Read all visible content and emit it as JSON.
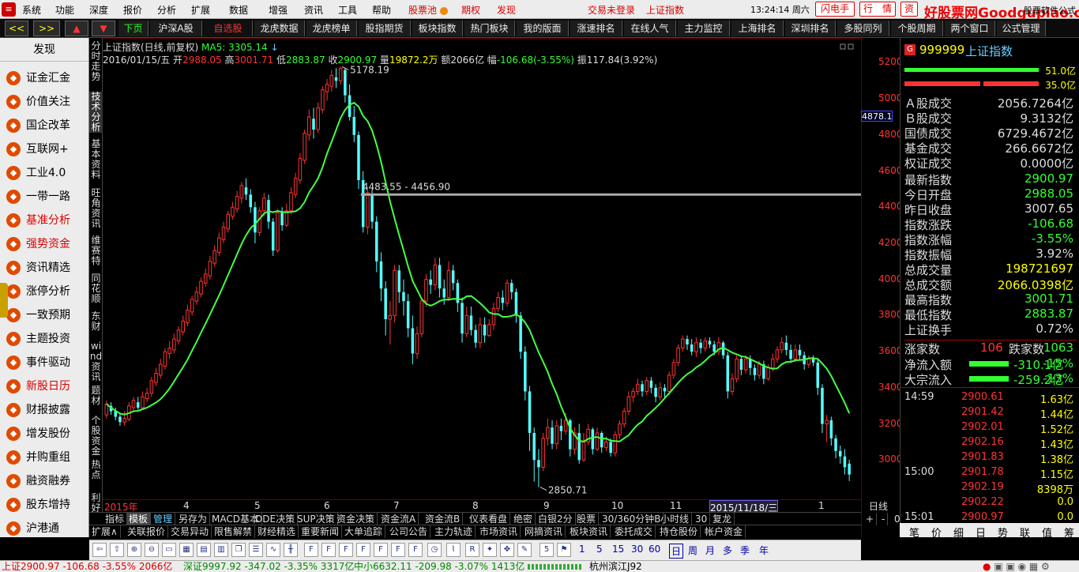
{
  "menubar": {
    "items": [
      "系统",
      "功能",
      "深度",
      "报价",
      "分析",
      "扩展",
      "数据",
      "增强",
      "资讯",
      "工具",
      "帮助"
    ],
    "pool_label": "股票池",
    "options_label": "期权",
    "discover_label": "发现",
    "login_status": "交易未登录",
    "index_name": "上证指数",
    "time": "13:24:14 周六",
    "flash_label": "闪电手",
    "quote_label": "行　情",
    "asset_label": "资",
    "brand": "好股票网Goodgupiao.com",
    "brand2": "股票软件公式"
  },
  "toolbar": {
    "nav": [
      "<<",
      ">>",
      "▲",
      "▼"
    ],
    "items": [
      "下页",
      "沪深A股",
      "自选股",
      "龙虎数据",
      "龙虎榜单",
      "股指期货",
      "板块指数",
      "热门板块",
      "我的版面",
      "涨速排名",
      "在线人气",
      "主力监控",
      "上海排名",
      "深圳排名",
      "多股同列",
      "个股周期",
      "两个窗口",
      "公式管理"
    ]
  },
  "sidebar": {
    "title": "发现",
    "items": [
      "证金汇金",
      "价值关注",
      "国企改革",
      "互联网+",
      "工业4.0",
      "一带一路",
      "基准分析",
      "强势资金",
      "资讯精选",
      "涨停分析",
      "一致预期",
      "主题投资",
      "事件驱动",
      "新股日历",
      "财报披露",
      "增发股份",
      "并购重组",
      "融资融券",
      "股东增持",
      "沪港通"
    ],
    "icons": [
      "chart-icon",
      "coin-icon",
      "globe-icon",
      "line-chart-icon",
      "gear-icon",
      "umbrella-icon",
      "scale-icon",
      "wallet-icon",
      "news-icon",
      "bars-icon",
      "target-icon",
      "bars-icon",
      "user-icon",
      "calendar-icon",
      "doc-icon",
      "people-icon",
      "link-icon",
      "money-icon",
      "user-icon",
      "bridge-icon"
    ]
  },
  "vtabs": [
    "分时走势",
    "技术分析",
    "基本资料",
    "旺角资讯",
    "维赛特",
    "同花顺",
    "东财",
    "wind资讯",
    "题材",
    "个股资金",
    "热点",
    "利好"
  ],
  "chart": {
    "title_line": "上证指数(日线,前复权)",
    "ma_label": "MA5: 3305.14",
    "info": {
      "date": "2016/01/15/五",
      "open_label": "开",
      "open": "2988.05",
      "high_label": "高",
      "high": "3001.71",
      "low_label": "低",
      "low": "2883.87",
      "close_label": "收",
      "close": "2900.97",
      "vol_label": "量",
      "vol": "19872.2万",
      "amt_label": "额",
      "amt": "2066亿",
      "chg_label": "幅",
      "chg": "-106.68(-3.55%)",
      "amp_label": "振",
      "amp": "117.84(3.92%)"
    },
    "annotations": {
      "high": "5178.19",
      "low": "2850.71",
      "range": "4483.55 - 4456.90"
    },
    "current_price_tag": "4878.1",
    "x_labels": [
      "2015年",
      "4",
      "5",
      "6",
      "7",
      "8",
      "9",
      "10",
      "11",
      "2015/11/18/三",
      "1"
    ],
    "period": "日线"
  },
  "chart_data": {
    "type": "candlestick",
    "title": "上证指数(日线,前复权)",
    "ylim": [
      2800,
      5250
    ],
    "yticks": [
      3000,
      3200,
      3400,
      3600,
      3800,
      4000,
      4200,
      4400,
      4600,
      4800,
      5000,
      5200
    ],
    "colors": {
      "up": "#ff3333",
      "down": "#55ffff",
      "ma": "#44ff44"
    },
    "ma5_last": 3305.14,
    "candles": [
      [
        3250,
        3310,
        3230,
        3330
      ],
      [
        3300,
        3270,
        3250,
        3320
      ],
      [
        3270,
        3240,
        3220,
        3290
      ],
      [
        3240,
        3210,
        3190,
        3260
      ],
      [
        3210,
        3230,
        3190,
        3270
      ],
      [
        3225,
        3300,
        3215,
        3320
      ],
      [
        3290,
        3330,
        3270,
        3350
      ],
      [
        3320,
        3290,
        3280,
        3350
      ],
      [
        3290,
        3350,
        3280,
        3380
      ],
      [
        3340,
        3370,
        3320,
        3400
      ],
      [
        3370,
        3440,
        3350,
        3460
      ],
      [
        3430,
        3480,
        3410,
        3510
      ],
      [
        3470,
        3530,
        3450,
        3560
      ],
      [
        3520,
        3600,
        3500,
        3620
      ],
      [
        3590,
        3620,
        3560,
        3660
      ],
      [
        3610,
        3670,
        3590,
        3700
      ],
      [
        3660,
        3720,
        3640,
        3740
      ],
      [
        3710,
        3770,
        3690,
        3800
      ],
      [
        3760,
        3830,
        3740,
        3860
      ],
      [
        3820,
        3890,
        3800,
        3910
      ],
      [
        3880,
        3930,
        3860,
        3960
      ],
      [
        3920,
        3990,
        3900,
        4010
      ],
      [
        3980,
        4030,
        3960,
        4060
      ],
      [
        4020,
        4100,
        4000,
        4130
      ],
      [
        4090,
        4160,
        4070,
        4190
      ],
      [
        4150,
        4230,
        4130,
        4260
      ],
      [
        4220,
        4290,
        4200,
        4320
      ],
      [
        4280,
        4360,
        4260,
        4380
      ],
      [
        4350,
        4400,
        4330,
        4430
      ],
      [
        4390,
        4460,
        4370,
        4490
      ],
      [
        4450,
        4520,
        4420,
        4540
      ],
      [
        4510,
        4470,
        4440,
        4560
      ],
      [
        4470,
        4400,
        4370,
        4500
      ],
      [
        4400,
        4260,
        4200,
        4430
      ],
      [
        4260,
        4380,
        4240,
        4400
      ],
      [
        4380,
        4450,
        4350,
        4480
      ],
      [
        4440,
        4320,
        4280,
        4470
      ],
      [
        4320,
        4160,
        4130,
        4340
      ],
      [
        4160,
        4370,
        4150,
        4390
      ],
      [
        4370,
        4300,
        4270,
        4400
      ],
      [
        4300,
        4380,
        4290,
        4420
      ],
      [
        4380,
        4480,
        4360,
        4510
      ],
      [
        4470,
        4560,
        4450,
        4590
      ],
      [
        4550,
        4670,
        4530,
        4700
      ],
      [
        4660,
        4810,
        4640,
        4830
      ],
      [
        4800,
        4900,
        4770,
        4940
      ],
      [
        4890,
        4830,
        4780,
        4950
      ],
      [
        4830,
        4950,
        4810,
        4980
      ],
      [
        4940,
        5050,
        4920,
        5070
      ],
      [
        5040,
        5080,
        4990,
        5110
      ],
      [
        5070,
        5130,
        5040,
        5160
      ],
      [
        5120,
        5100,
        5060,
        5170
      ],
      [
        5100,
        5170,
        5080,
        5178
      ],
      [
        5160,
        5020,
        4980,
        5170
      ],
      [
        5020,
        4900,
        4880,
        5080
      ],
      [
        4900,
        4800,
        4760,
        4960
      ],
      [
        4800,
        4550,
        4500,
        4820
      ],
      [
        4550,
        4290,
        4260,
        4600
      ],
      [
        4290,
        4480,
        4250,
        4500
      ],
      [
        4470,
        4320,
        4280,
        4500
      ],
      [
        4320,
        4100,
        4040,
        4350
      ],
      [
        4100,
        3950,
        3880,
        4150
      ],
      [
        3950,
        3780,
        3690,
        3990
      ],
      [
        3780,
        3800,
        3640,
        3880
      ],
      [
        3800,
        4050,
        3760,
        4080
      ],
      [
        4050,
        3930,
        3870,
        4080
      ],
      [
        3930,
        3880,
        3800,
        4000
      ],
      [
        3880,
        3730,
        3680,
        3920
      ],
      [
        3730,
        3590,
        3530,
        3800
      ],
      [
        3590,
        3700,
        3560,
        3740
      ],
      [
        3700,
        3880,
        3680,
        3900
      ],
      [
        3880,
        4000,
        3850,
        4030
      ],
      [
        4000,
        3970,
        3920,
        4050
      ],
      [
        3970,
        4080,
        3940,
        4120
      ],
      [
        4080,
        3950,
        3900,
        4120
      ],
      [
        3950,
        3900,
        3860,
        4000
      ],
      [
        3900,
        4050,
        3880,
        4100
      ],
      [
        4050,
        3980,
        3940,
        4080
      ],
      [
        3980,
        3870,
        3820,
        4000
      ],
      [
        3870,
        3700,
        3650,
        3900
      ],
      [
        3700,
        3800,
        3680,
        3850
      ],
      [
        3800,
        3720,
        3690,
        3850
      ],
      [
        3720,
        3650,
        3620,
        3750
      ],
      [
        3650,
        3750,
        3620,
        3790
      ],
      [
        3750,
        3690,
        3650,
        3790
      ],
      [
        3690,
        3750,
        3680,
        3780
      ],
      [
        3750,
        3840,
        3720,
        3870
      ],
      [
        3840,
        3900,
        3820,
        3930
      ],
      [
        3900,
        3870,
        3830,
        3940
      ],
      [
        3870,
        3980,
        3850,
        4000
      ],
      [
        3980,
        3930,
        3890,
        4000
      ],
      [
        3930,
        3800,
        3760,
        3950
      ],
      [
        3800,
        3600,
        3560,
        3820
      ],
      [
        3600,
        3380,
        3330,
        3630
      ],
      [
        3380,
        3150,
        3050,
        3410
      ],
      [
        3150,
        3000,
        2880,
        3180
      ],
      [
        3000,
        2960,
        2850,
        3060
      ],
      [
        2960,
        3120,
        2940,
        3150
      ],
      [
        3120,
        3180,
        3080,
        3230
      ],
      [
        3180,
        3090,
        3060,
        3220
      ],
      [
        3090,
        3190,
        3060,
        3220
      ],
      [
        3190,
        3160,
        3110,
        3230
      ],
      [
        3160,
        3220,
        3140,
        3260
      ],
      [
        3220,
        3060,
        3020,
        3230
      ],
      [
        3060,
        3150,
        3030,
        3180
      ],
      [
        3150,
        3000,
        2980,
        3200
      ],
      [
        3000,
        3100,
        2990,
        3150
      ],
      [
        3100,
        3170,
        3080,
        3200
      ],
      [
        3170,
        3060,
        3030,
        3180
      ],
      [
        3060,
        3150,
        3050,
        3180
      ],
      [
        3150,
        3070,
        3040,
        3160
      ],
      [
        3070,
        3100,
        3050,
        3130
      ],
      [
        3100,
        3040,
        3020,
        3120
      ],
      [
        3040,
        3140,
        3020,
        3160
      ],
      [
        3140,
        3200,
        3120,
        3220
      ],
      [
        3200,
        3270,
        3180,
        3290
      ],
      [
        3270,
        3350,
        3250,
        3380
      ],
      [
        3350,
        3380,
        3320,
        3400
      ],
      [
        3380,
        3420,
        3360,
        3450
      ],
      [
        3420,
        3380,
        3350,
        3440
      ],
      [
        3380,
        3440,
        3360,
        3460
      ],
      [
        3440,
        3400,
        3370,
        3460
      ],
      [
        3400,
        3350,
        3320,
        3420
      ],
      [
        3350,
        3400,
        3330,
        3430
      ],
      [
        3400,
        3380,
        3340,
        3420
      ],
      [
        3380,
        3470,
        3360,
        3490
      ],
      [
        3470,
        3540,
        3450,
        3560
      ],
      [
        3540,
        3620,
        3520,
        3640
      ],
      [
        3620,
        3670,
        3600,
        3690
      ],
      [
        3670,
        3640,
        3610,
        3690
      ],
      [
        3640,
        3600,
        3580,
        3670
      ],
      [
        3600,
        3650,
        3570,
        3680
      ],
      [
        3650,
        3620,
        3590,
        3670
      ],
      [
        3620,
        3660,
        3600,
        3680
      ],
      [
        3660,
        3640,
        3620,
        3680
      ],
      [
        3640,
        3600,
        3580,
        3660
      ],
      [
        3600,
        3650,
        3580,
        3680
      ],
      [
        3650,
        3580,
        3560,
        3660
      ],
      [
        3580,
        3380,
        3340,
        3600
      ],
      [
        3380,
        3450,
        3360,
        3480
      ],
      [
        3450,
        3560,
        3430,
        3580
      ],
      [
        3560,
        3500,
        3470,
        3580
      ],
      [
        3500,
        3560,
        3480,
        3580
      ],
      [
        3560,
        3510,
        3470,
        3580
      ],
      [
        3510,
        3470,
        3440,
        3530
      ],
      [
        3470,
        3530,
        3450,
        3550
      ],
      [
        3530,
        3450,
        3420,
        3550
      ],
      [
        3450,
        3510,
        3440,
        3530
      ],
      [
        3510,
        3560,
        3490,
        3590
      ],
      [
        3560,
        3610,
        3540,
        3630
      ],
      [
        3610,
        3650,
        3590,
        3680
      ],
      [
        3650,
        3610,
        3580,
        3690
      ],
      [
        3610,
        3560,
        3540,
        3640
      ],
      [
        3560,
        3610,
        3540,
        3640
      ],
      [
        3610,
        3580,
        3550,
        3640
      ],
      [
        3580,
        3530,
        3500,
        3600
      ],
      [
        3530,
        3560,
        3510,
        3580
      ],
      [
        3560,
        3540,
        3520,
        3580
      ],
      [
        3540,
        3400,
        3360,
        3560
      ],
      [
        3400,
        3200,
        3150,
        3420
      ],
      [
        3200,
        3220,
        3100,
        3250
      ],
      [
        3220,
        3120,
        3080,
        3240
      ],
      [
        3120,
        3050,
        3010,
        3140
      ],
      [
        3050,
        3020,
        2980,
        3080
      ],
      [
        3020,
        2960,
        2920,
        3060
      ],
      [
        2980,
        2920,
        2884,
        3002
      ]
    ]
  },
  "yaxis": [
    "5200",
    "5000",
    "4800",
    "4600",
    "4400",
    "4200",
    "4000",
    "3800",
    "3600",
    "3400",
    "3200",
    "3000"
  ],
  "tabs_row1": [
    "指标",
    "模板",
    "管理",
    "另存为",
    "MACD基本",
    "DDE决策",
    "SUP决策",
    "资金决策",
    "资金流A",
    "资金流B",
    "仪表看盘",
    "绝密",
    "白银2分",
    "股票",
    "30/360分钟B",
    "小时线",
    "30",
    "复龙"
  ],
  "tabs_row1_extra": [
    "+",
    "-",
    "0"
  ],
  "tabs_row2": [
    "扩展∧",
    "关联报价",
    "交易异动",
    "限售解禁",
    "财经精选",
    "重要新闻",
    "大单追踪",
    "公司公告",
    "主力轨迹",
    "市场资讯",
    "网摘资讯",
    "板块资讯",
    "委托成交",
    "持仓股份",
    "帐户资金"
  ],
  "drawtools": {
    "periods": [
      "1",
      "5",
      "15",
      "30",
      "60",
      "日",
      "周",
      "月",
      "多",
      "季",
      "年"
    ]
  },
  "rightpanel": {
    "code": "999999",
    "name": "上证指数",
    "bar1_pct": "51.0亿",
    "bar2_pct": "35.0亿",
    "rows": [
      {
        "label": "Ａ股成交",
        "value": "2056.7264亿",
        "cls": ""
      },
      {
        "label": "Ｂ股成交",
        "value": "9.3132亿",
        "cls": ""
      },
      {
        "label": "国债成交",
        "value": "6729.4672亿",
        "cls": ""
      },
      {
        "label": "基金成交",
        "value": "266.6672亿",
        "cls": ""
      },
      {
        "label": "权证成交",
        "value": "0.0000亿",
        "cls": ""
      },
      {
        "label": "最新指数",
        "value": "2900.97",
        "cls": "g"
      },
      {
        "label": "今日开盘",
        "value": "2988.05",
        "cls": "g"
      },
      {
        "label": "昨日收盘",
        "value": "3007.65",
        "cls": ""
      },
      {
        "label": "指数涨跌",
        "value": "-106.68",
        "cls": "g"
      },
      {
        "label": "指数涨幅",
        "value": "-3.55%",
        "cls": "g"
      },
      {
        "label": "指数振幅",
        "value": "3.92%",
        "cls": ""
      },
      {
        "label": "总成交量",
        "value": "198721697",
        "cls": "y"
      },
      {
        "label": "总成交额",
        "value": "2066.0398亿",
        "cls": "y"
      },
      {
        "label": "最高指数",
        "value": "3001.71",
        "cls": "g"
      },
      {
        "label": "最低指数",
        "value": "2883.87",
        "cls": "g"
      },
      {
        "label": "上证换手",
        "value": "0.72%",
        "cls": ""
      }
    ],
    "rise_label": "涨家数",
    "rise": "106",
    "fall_label": "跌家数",
    "fall": "1063",
    "netflow_label": "净流入额",
    "netflow": "-310.1亿",
    "netflow_pct": "-15%",
    "bigdeal_label": "大宗流入",
    "bigdeal": "-259.2亿",
    "bigdeal_pct": "-13%",
    "ticks": [
      {
        "t": "14:59",
        "p": "2900.61",
        "v": "1.63亿"
      },
      {
        "t": "",
        "p": "2901.42",
        "v": "1.44亿"
      },
      {
        "t": "",
        "p": "2902.01",
        "v": "1.52亿"
      },
      {
        "t": "",
        "p": "2902.16",
        "v": "1.43亿"
      },
      {
        "t": "",
        "p": "2901.83",
        "v": "1.38亿"
      },
      {
        "t": "15:00",
        "p": "2901.78",
        "v": "1.15亿"
      },
      {
        "t": "",
        "p": "2902.19",
        "v": "8398万"
      },
      {
        "t": "",
        "p": "2902.22",
        "v": "0.0"
      },
      {
        "t": "15:01",
        "p": "2900.97",
        "v": "0.0"
      }
    ],
    "bottom_tabs": [
      "笔",
      "价",
      "细",
      "日",
      "势",
      "联",
      "值",
      "筹"
    ]
  },
  "statusbar": {
    "sh": "上证2900.97 -106.68 -3.55% 2066亿",
    "sz": "深证9997.92 -347.02 -3.35% 3317亿",
    "zx": "中小6632.11 -209.98 -3.07% 1413亿",
    "location": "杭州滨江J92"
  }
}
